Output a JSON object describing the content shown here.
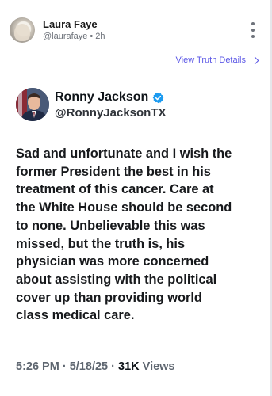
{
  "post": {
    "author_name": "Laura Faye",
    "author_handle": "@laurafaye",
    "separator": "•",
    "age": "2h",
    "view_details_label": "View Truth Details"
  },
  "embedded_tweet": {
    "name": "Ronny Jackson",
    "handle": "@RonnyJacksonTX",
    "verified": true,
    "body_lines": [
      "Sad and unfortunate and I wish the",
      "former President the best in his",
      "treatment of this cancer. Care at",
      "the White House should be second",
      "to none. Unbelievable this was",
      "missed, but the truth is, his",
      "physician was more concerned",
      "about assisting with the political",
      "cover up than providing world",
      "class medical care."
    ],
    "time": "5:26 PM",
    "date": "5/18/25",
    "views_count": "31K",
    "views_label": "Views",
    "stat_sep": "·"
  },
  "colors": {
    "link": "#5b57e6",
    "verified_badge": "#1d9bf0",
    "text_primary": "#0f1419",
    "text_secondary": "#6b7078"
  },
  "icons": [
    "more-vertical-icon",
    "chevron-right-icon",
    "verified-badge-icon"
  ]
}
